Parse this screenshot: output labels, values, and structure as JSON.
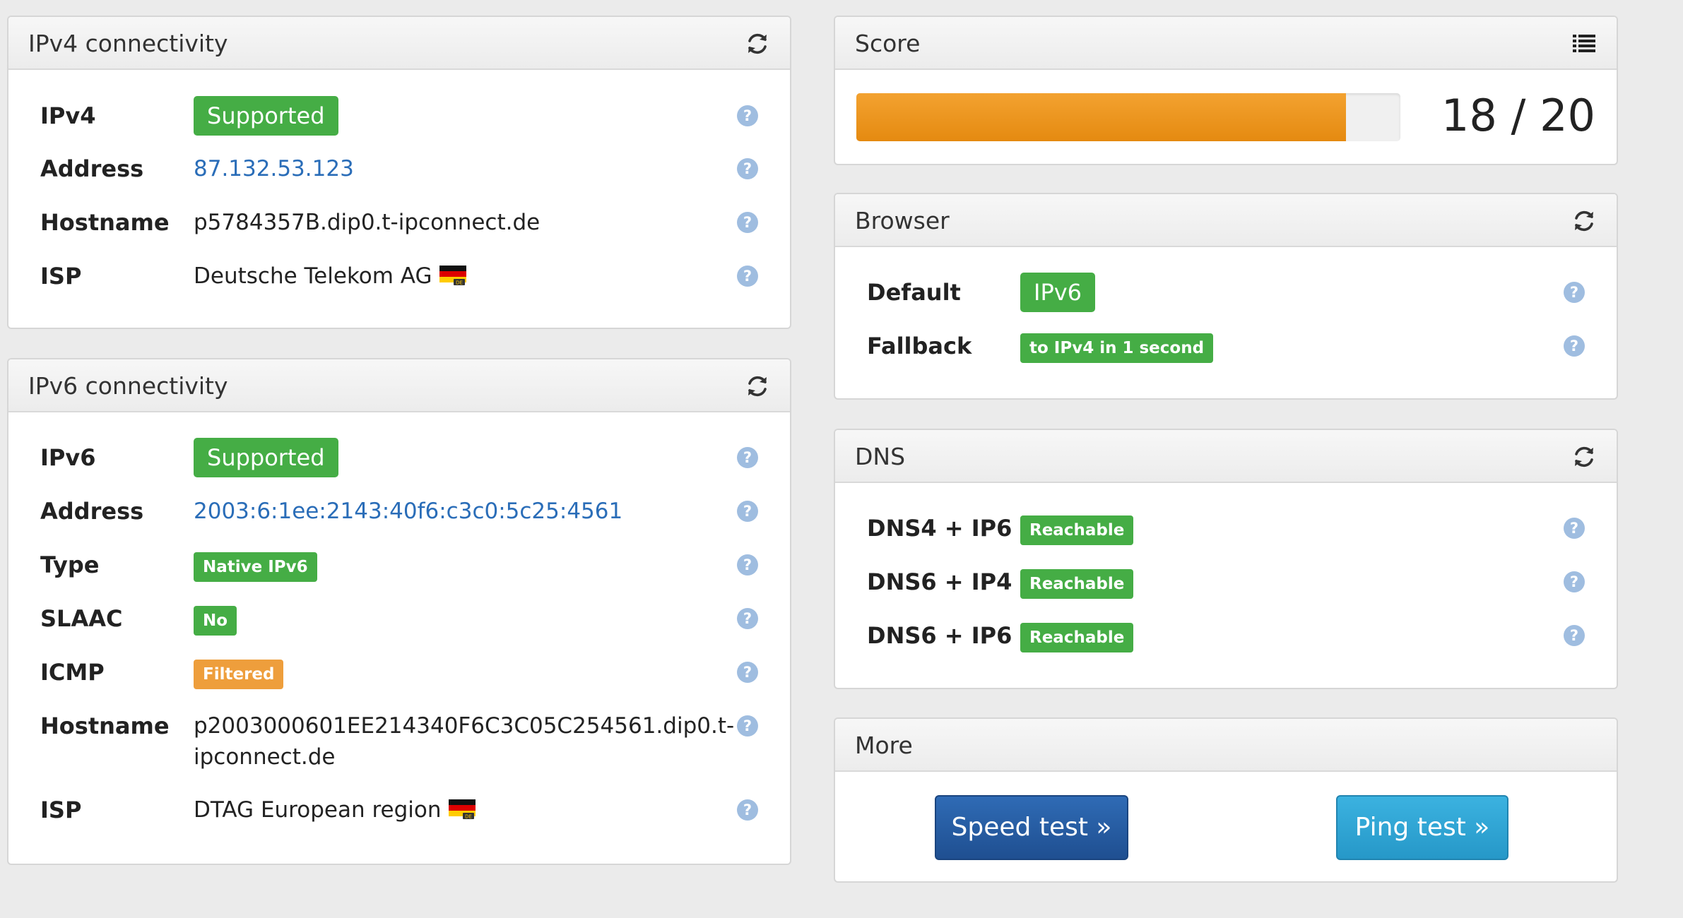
{
  "ipv4": {
    "title": "IPv4 connectivity",
    "rows": [
      {
        "label": "IPv4",
        "value": "Supported"
      },
      {
        "label": "Address",
        "value": "87.132.53.123"
      },
      {
        "label": "Hostname",
        "value": "p5784357B.dip0.t-ipconnect.de"
      },
      {
        "label": "ISP",
        "value": "Deutsche Telekom AG"
      }
    ]
  },
  "ipv6": {
    "title": "IPv6 connectivity",
    "rows": [
      {
        "label": "IPv6",
        "value": "Supported"
      },
      {
        "label": "Address",
        "value": "2003:6:1ee:2143:40f6:c3c0:5c25:4561"
      },
      {
        "label": "Type",
        "value": "Native IPv6"
      },
      {
        "label": "SLAAC",
        "value": "No"
      },
      {
        "label": "ICMP",
        "value": "Filtered"
      },
      {
        "label": "Hostname",
        "value": "p2003000601EE214340F6C3C05C254561.dip0.t-",
        "value2": "ipconnect.de"
      },
      {
        "label": "ISP",
        "value": "DTAG European region"
      }
    ]
  },
  "score": {
    "title": "Score",
    "points": 18,
    "max": 20,
    "text": "18 / 20"
  },
  "browser": {
    "title": "Browser",
    "rows": [
      {
        "label": "Default",
        "value": "IPv6"
      },
      {
        "label": "Fallback",
        "value": "to IPv4 in 1 second"
      }
    ]
  },
  "dns": {
    "title": "DNS",
    "rows": [
      {
        "label": "DNS4 + IP6",
        "value": "Reachable"
      },
      {
        "label": "DNS6 + IP4",
        "value": "Reachable"
      },
      {
        "label": "DNS6 + IP6",
        "value": "Reachable"
      }
    ]
  },
  "more": {
    "title": "More",
    "speed_button": "Speed test »",
    "ping_button": "Ping test »"
  },
  "flag_badge": "DE",
  "help_glyph": "?",
  "colors": {
    "success": "#45ad45",
    "warning": "#ee9e3c",
    "link": "#2a6db8",
    "progress": "#e58a10",
    "help": "#9fbde0"
  },
  "icons": {
    "refresh": "refresh-icon",
    "list": "list-icon",
    "help": "help-icon",
    "flag": "germany-flag-icon"
  }
}
